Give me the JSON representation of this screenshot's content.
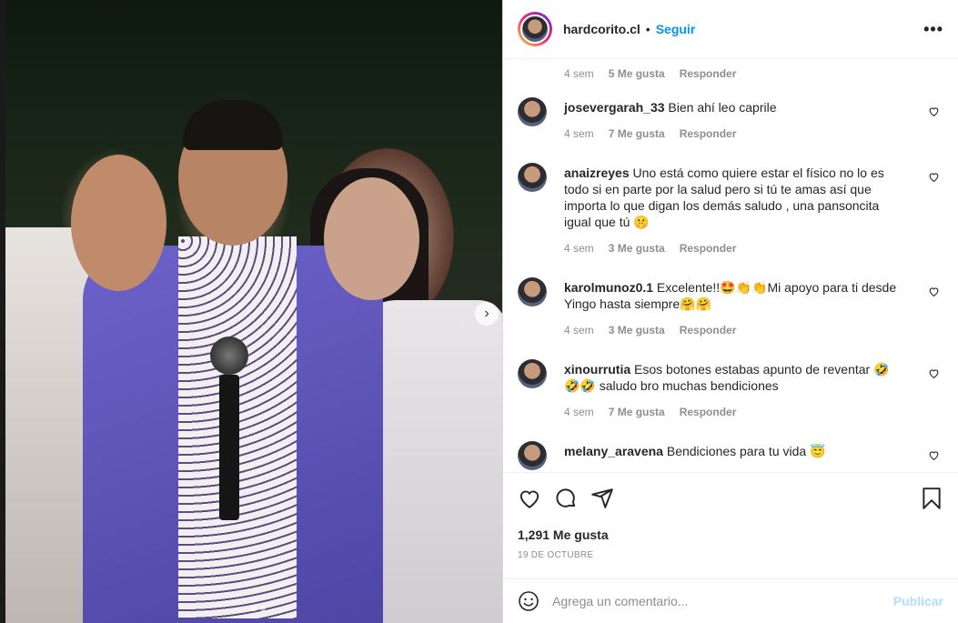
{
  "post": {
    "username": "hardcorito.cl",
    "separator": "•",
    "follow_label": "Seguir",
    "more_label": "•••",
    "next_label": "›",
    "likes_text": "1,291 Me gusta",
    "date_text": "19 DE OCTUBRE",
    "carousel_dots": 2,
    "carousel_active": 0
  },
  "comments": [
    {
      "user": "",
      "text": "",
      "age": "4 sem",
      "likes": "5 Me gusta",
      "reply": "Responder"
    },
    {
      "user": "josevergarah_33",
      "text": "Bien ahí leo caprile",
      "age": "4 sem",
      "likes": "7 Me gusta",
      "reply": "Responder"
    },
    {
      "user": "anaizreyes",
      "text": "Uno está como quiere estar el físico no lo es todo si en parte por la salud pero si tú te amas así que importa lo que digan los demás saludo , una pansoncita igual que tú 🤫",
      "age": "4 sem",
      "likes": "3 Me gusta",
      "reply": "Responder"
    },
    {
      "user": "karolmunoz0.1",
      "text": "Excelente!!🤩👏👏Mi apoyo para ti desde Yingo hasta siempre🤗🤗",
      "age": "4 sem",
      "likes": "3 Me gusta",
      "reply": "Responder"
    },
    {
      "user": "xinourrutia",
      "text": "Esos botones estabas apunto de reventar 🤣🤣🤣 saludo bro muchas bendiciones",
      "age": "4 sem",
      "likes": "7 Me gusta",
      "reply": "Responder"
    },
    {
      "user": "melany_aravena",
      "text": "Bendiciones para tu vida 😇",
      "age": "",
      "likes": "",
      "reply": ""
    }
  ],
  "add_comment": {
    "placeholder": "Agrega un comentario...",
    "publish_label": "Publicar"
  },
  "colors": {
    "accent": "#0095f6",
    "publish_disabled": "#b2dffc",
    "text": "#262626",
    "muted": "#8e8e8e"
  },
  "icons": [
    "heart-icon",
    "comment-icon",
    "share-icon",
    "bookmark-icon",
    "emoji-icon",
    "more-icon",
    "chevron-right-icon"
  ]
}
